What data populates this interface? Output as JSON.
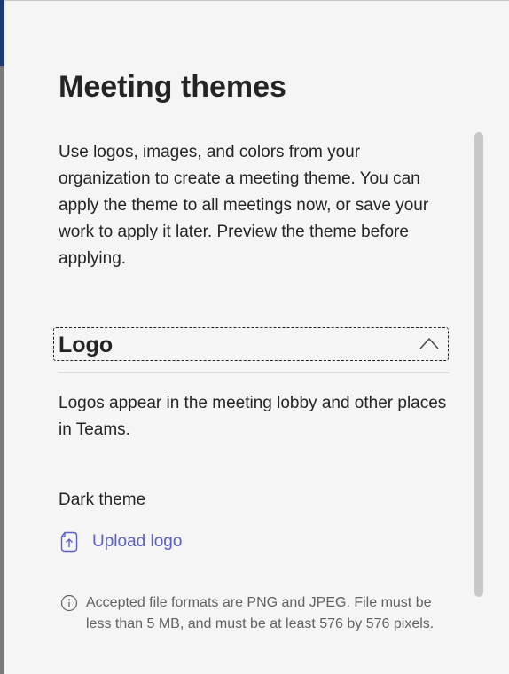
{
  "panel": {
    "title": "Meeting themes",
    "description": "Use logos, images, and colors from your organization to create a meeting theme. You can apply the theme to all meetings now, or save your work to apply it later. Preview the theme before applying."
  },
  "logo_section": {
    "header": "Logo",
    "expanded": true,
    "chevron_icon": "chevron-up-icon",
    "description": "Logos appear in the meeting lobby and other places in Teams.",
    "dark_theme_label": "Dark theme",
    "upload_label": "Upload logo",
    "upload_icon": "upload-file-icon",
    "info_icon": "info-icon",
    "info_text": "Accepted file formats are PNG and JPEG. File must be less than 5 MB, and must be at least 576 by 576 pixels."
  },
  "colors": {
    "accent": "#5b5fc7",
    "text": "#242424",
    "muted_text": "#616161",
    "background": "#f5f5f5",
    "scrollbar": "#c7c7c7"
  }
}
